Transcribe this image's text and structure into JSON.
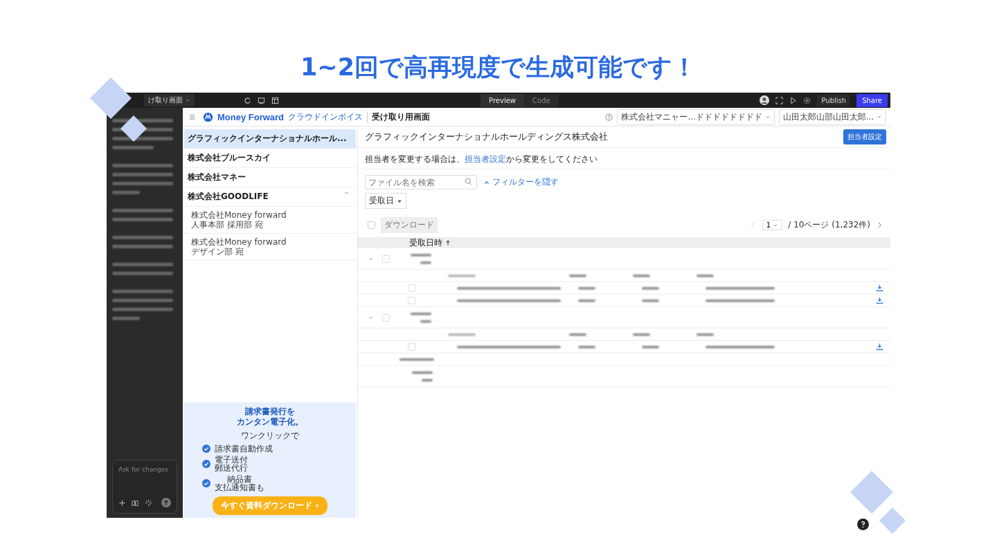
{
  "headline": "1~2回で高再現度で生成可能です！",
  "editor_bar": {
    "tab_label": "け取り画面",
    "view_tabs": [
      {
        "label": "Preview",
        "selected": true
      },
      {
        "label": "Code",
        "selected": false
      }
    ],
    "publish": "Publish",
    "share": "Share"
  },
  "chat_panel": {
    "input_placeholder": "Ask for changes"
  },
  "app_header": {
    "brand": "Money Forward",
    "product": "クラウドインボイス",
    "page": "受け取り用画面",
    "company_select": "株式会社マニャー...ドドドドドドドド",
    "user_select": "山田太郎山部山田太郎..."
  },
  "sidebar": {
    "items": [
      {
        "label": "グラフィックインターナショナルホール...",
        "selected": true
      },
      {
        "label": "株式会社ブルースカイ",
        "selected": false
      },
      {
        "label": "株式会社マネー",
        "selected": false
      },
      {
        "label": "株式会社GOODLIFE",
        "selected": false,
        "expanded": true,
        "children": [
          {
            "lines": [
              "株式会社Money forward",
              "人事本部 採用部 宛"
            ]
          },
          {
            "lines": [
              "株式会社Money forward",
              "デザイン部 宛"
            ]
          }
        ]
      }
    ]
  },
  "ad": {
    "title_lines": [
      "請求書発行を",
      "カンタン電子化。"
    ],
    "subtitle": "ワンクリックで",
    "features": [
      {
        "lines": [
          "請求書自動作成"
        ]
      },
      {
        "lines": [
          "電子送付",
          "郵送代行"
        ]
      },
      {
        "lines": [
          "納品書",
          "支払通知書も"
        ]
      }
    ],
    "cta": "今すぐ資料ダウンロード ›"
  },
  "main": {
    "title": "グラフィックインターナショナルホールディングス株式会社",
    "assign_button": "担当者設定",
    "notice_before": "担当者を変更する場合は、",
    "notice_link": "担当者設定",
    "notice_after": "から変更をしてください",
    "search_placeholder": "ファイル名を検索",
    "filter_toggle": "フィルターを隠す",
    "date_filter": "受取日",
    "download_button": "ダウンロード",
    "page_select": "1",
    "page_info": "/ 10ページ (1,232件)",
    "sort_column": "受取日時"
  },
  "select_all_checked": false,
  "table": {
    "rows": [
      {
        "kind": "group",
        "checked": false
      },
      {
        "kind": "subheader"
      },
      {
        "kind": "file",
        "checked": false
      },
      {
        "kind": "file",
        "checked": false
      },
      {
        "kind": "group",
        "checked": false
      },
      {
        "kind": "subheader"
      },
      {
        "kind": "file",
        "checked": false
      },
      {
        "kind": "date"
      },
      {
        "kind": "group_plain"
      }
    ]
  }
}
